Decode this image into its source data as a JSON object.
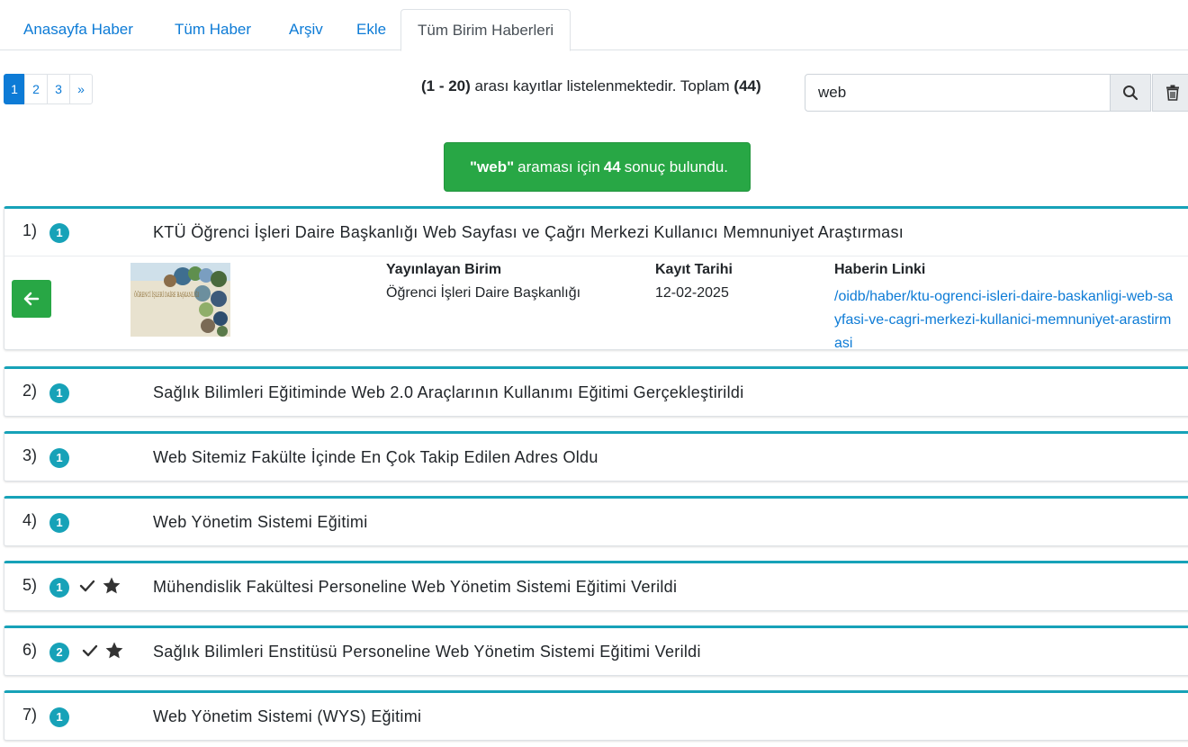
{
  "tabs": [
    {
      "label": "Anasayfa Haber"
    },
    {
      "label": "Tüm Haber"
    },
    {
      "label": "Arşiv"
    },
    {
      "label": "Ekle"
    },
    {
      "label": "Tüm Birim Haberleri"
    }
  ],
  "pagination": {
    "pages": [
      "1",
      "2",
      "3",
      "»"
    ],
    "active": "1"
  },
  "records": {
    "range": "(1 - 20)",
    "text": "arası kayıtlar listelenmektedir. Toplam",
    "total": "(44)"
  },
  "search": {
    "value": "web",
    "placeholder": ""
  },
  "alert": {
    "query": "\"web\"",
    "middle": "araması için",
    "count": "44",
    "suffix": "sonuç bulundu."
  },
  "detail": {
    "col1_head": "Yayınlayan Birim",
    "col1_val": "Öğrenci İşleri Daire Başkanlığı",
    "col2_head": "Kayıt Tarihi",
    "col2_val": "12-02-2025",
    "col3_head": "Haberin Linki",
    "col3_val": "/oidb/haber/ktu-ogrenci-isleri-daire-baskanligi-web-sayfasi-ve-cagri-merkezi-kullanici-memnuniyet-arastirmasi",
    "thumb_text": "ÖĞRENCİ İŞLERİ DAİRE BAŞKANLIĞI"
  },
  "items": [
    {
      "num": "1)",
      "badge": "1",
      "check": false,
      "star": false,
      "title": "KTÜ Öğrenci İşleri Daire Başkanlığı Web Sayfası ve Çağrı Merkezi Kullanıcı Memnuniyet Araştırması"
    },
    {
      "num": "2)",
      "badge": "1",
      "check": false,
      "star": false,
      "title": "Sağlık Bilimleri Eğitiminde Web 2.0 Araçlarının Kullanımı Eğitimi Gerçekleştirildi"
    },
    {
      "num": "3)",
      "badge": "1",
      "check": false,
      "star": false,
      "title": "Web Sitemiz Fakülte İçinde En Çok Takip Edilen Adres Oldu"
    },
    {
      "num": "4)",
      "badge": "1",
      "check": false,
      "star": false,
      "title": "Web Yönetim Sistemi Eğitimi"
    },
    {
      "num": "5)",
      "badge": "1",
      "check": true,
      "star": true,
      "title": "Mühendislik Fakültesi Personeline Web Yönetim Sistemi Eğitimi Verildi"
    },
    {
      "num": "6)",
      "badge": "2",
      "check": true,
      "star": true,
      "title": "Sağlık Bilimleri Enstitüsü Personeline Web Yönetim Sistemi Eğitimi Verildi"
    },
    {
      "num": "7)",
      "badge": "1",
      "check": false,
      "star": false,
      "title": "Web Yönetim Sistemi (WYS) Eğitimi"
    }
  ],
  "icons": {
    "search": "search-icon",
    "delete": "trash-icon",
    "back": "arrow-left-icon",
    "check": "check-icon",
    "star": "star-icon"
  },
  "colors": {
    "primary": "#0d7bd6",
    "success": "#28a745",
    "info": "#17a2b8"
  }
}
